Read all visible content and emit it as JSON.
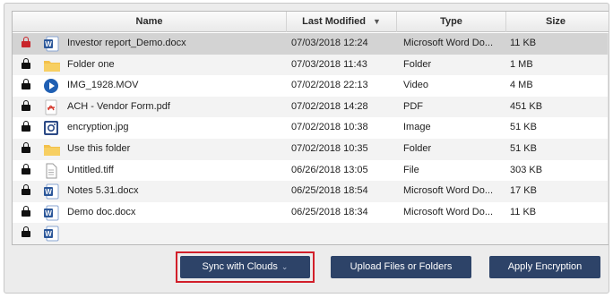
{
  "columns": {
    "name": "Name",
    "modified": "Last Modified",
    "sort_indicator": "▼",
    "type": "Type",
    "size": "Size"
  },
  "files": [
    {
      "name": "Investor report_Demo.docx",
      "modified": "07/03/2018 12:24",
      "type": "Microsoft Word Do...",
      "size": "11 KB",
      "icon": "word-doc-icon",
      "lock": "lock-red",
      "selected": true
    },
    {
      "name": "Folder one",
      "modified": "07/03/2018 11:43",
      "type": "Folder",
      "size": "1 MB",
      "icon": "folder-icon",
      "lock": "lock"
    },
    {
      "name": "IMG_1928.MOV",
      "modified": "07/02/2018 22:13",
      "type": "Video",
      "size": "4 MB",
      "icon": "video-play-icon",
      "lock": "lock"
    },
    {
      "name": "ACH - Vendor Form.pdf",
      "modified": "07/02/2018 14:28",
      "type": "PDF",
      "size": "451 KB",
      "icon": "pdf-icon",
      "lock": "lock"
    },
    {
      "name": "encryption.jpg",
      "modified": "07/02/2018 10:38",
      "type": "Image",
      "size": "51 KB",
      "icon": "image-icon",
      "lock": "lock"
    },
    {
      "name": "Use this folder",
      "modified": "07/02/2018 10:35",
      "type": "Folder",
      "size": "51 KB",
      "icon": "folder-icon",
      "lock": "lock"
    },
    {
      "name": "Untitled.tiff",
      "modified": "06/26/2018 13:05",
      "type": "File",
      "size": "303 KB",
      "icon": "file-icon",
      "lock": "lock"
    },
    {
      "name": "Notes 5.31.docx",
      "modified": "06/25/2018 18:54",
      "type": "Microsoft Word Do...",
      "size": "17 KB",
      "icon": "word-doc-icon",
      "lock": "lock"
    },
    {
      "name": "Demo doc.docx",
      "modified": "06/25/2018 18:34",
      "type": "Microsoft Word Do...",
      "size": "11 KB",
      "icon": "word-doc-icon",
      "lock": "lock"
    },
    {
      "name": "",
      "modified": "",
      "type": "",
      "size": "",
      "icon": "word-doc-icon",
      "lock": "lock",
      "partial": true
    }
  ],
  "buttons": {
    "sync": "Sync with Clouds",
    "sync_chevron": "⌄",
    "upload": "Upload Files or Folders",
    "encrypt": "Apply Encryption"
  },
  "colors": {
    "button_bg": "#2d4368",
    "highlight": "#d21f2a",
    "lock_red": "#c9252b",
    "word_blue": "#2b579a",
    "folder_yellow": "#f3c14b",
    "video_blue": "#1f5fb3",
    "pdf_red": "#d53b2f"
  }
}
